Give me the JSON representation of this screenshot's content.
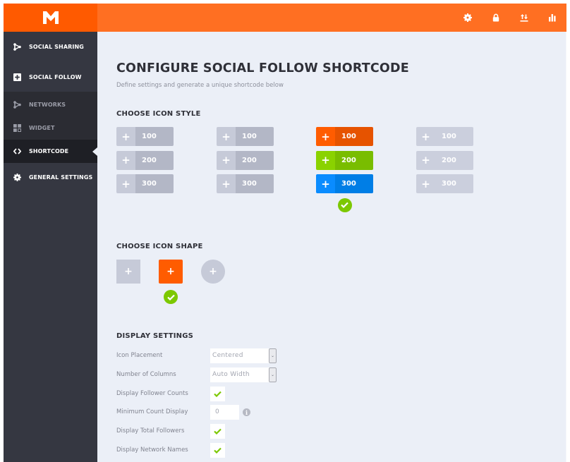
{
  "colors": {
    "brand_orange": "#ff6f22",
    "logo_bg": "#ff5a00",
    "sidebar_bg": "#353741",
    "content_bg": "#ebeff7",
    "check_green": "#7cc800"
  },
  "topbar": {
    "logo": "M",
    "icons": [
      {
        "name": "gear-icon",
        "label": "Settings"
      },
      {
        "name": "lock-icon",
        "label": "License"
      },
      {
        "name": "import-export-icon",
        "label": "Import/Export"
      },
      {
        "name": "stats-icon",
        "label": "Statistics"
      }
    ]
  },
  "sidebar": {
    "items": [
      {
        "label": "SOCIAL SHARING",
        "icon": "share-icon"
      },
      {
        "label": "SOCIAL FOLLOW",
        "icon": "plus-square-icon"
      }
    ],
    "subitems": [
      {
        "label": "NETWORKS",
        "icon": "share-icon",
        "active": false
      },
      {
        "label": "WIDGET",
        "icon": "grid-icon",
        "active": false
      },
      {
        "label": "SHORTCODE",
        "icon": "code-icon",
        "active": true
      }
    ],
    "general": {
      "label": "GENERAL SETTINGS",
      "icon": "gear-icon"
    }
  },
  "main": {
    "title": "CONFIGURE SOCIAL FOLLOW SHORTCODE",
    "subtitle": "Define settings and generate a unique shortcode below",
    "icon_style": {
      "heading": "CHOOSE ICON STYLE",
      "selected_index": 2,
      "styles": [
        {
          "name": "style-1",
          "buttons": [
            {
              "plus": "+",
              "count": "100",
              "plus_color": "#c6cad8",
              "num_color": "#b3b7c6"
            },
            {
              "plus": "+",
              "count": "200",
              "plus_color": "#c6cad8",
              "num_color": "#b3b7c6"
            },
            {
              "plus": "+",
              "count": "300",
              "plus_color": "#c6cad8",
              "num_color": "#b3b7c6"
            }
          ]
        },
        {
          "name": "style-2",
          "buttons": [
            {
              "plus": "+",
              "count": "100",
              "plus_color": "#c6cad8",
              "num_color": "#b3b7c6"
            },
            {
              "plus": "+",
              "count": "200",
              "plus_color": "#c6cad8",
              "num_color": "#b3b7c6"
            },
            {
              "plus": "+",
              "count": "300",
              "plus_color": "#c6cad8",
              "num_color": "#b3b7c6"
            }
          ]
        },
        {
          "name": "style-3",
          "buttons": [
            {
              "plus": "+",
              "count": "100",
              "plus_color": "#ff5c00",
              "num_color": "#e65300"
            },
            {
              "plus": "+",
              "count": "200",
              "plus_color": "#8ad200",
              "num_color": "#79bd00"
            },
            {
              "plus": "+",
              "count": "300",
              "plus_color": "#0a8cff",
              "num_color": "#007ee6"
            }
          ]
        },
        {
          "name": "style-4",
          "buttons": [
            {
              "plus": "+",
              "count": "100",
              "plus_color": "#cbcfdd",
              "num_color": "#cbcfdd"
            },
            {
              "plus": "+",
              "count": "200",
              "plus_color": "#cbcfdd",
              "num_color": "#cbcfdd"
            },
            {
              "plus": "+",
              "count": "300",
              "plus_color": "#cbcfdd",
              "num_color": "#cbcfdd"
            }
          ]
        }
      ]
    },
    "icon_shape": {
      "heading": "CHOOSE ICON SHAPE",
      "selected_index": 1,
      "shapes": [
        {
          "name": "square",
          "plus": "+"
        },
        {
          "name": "rounded",
          "plus": "+"
        },
        {
          "name": "circle",
          "plus": "+"
        }
      ]
    },
    "display_settings": {
      "heading": "DISPLAY SETTINGS",
      "icon_placement": {
        "label": "Icon Placement",
        "value": "Centered"
      },
      "columns": {
        "label": "Number of Columns",
        "value": "Auto Width"
      },
      "follower_counts": {
        "label": "Display Follower Counts",
        "checked": true
      },
      "min_count": {
        "label": "Minimum Count Display",
        "value": "0"
      },
      "total_followers": {
        "label": "Display Total Followers",
        "checked": true
      },
      "network_names": {
        "label": "Display Network Names",
        "checked": true
      }
    }
  }
}
